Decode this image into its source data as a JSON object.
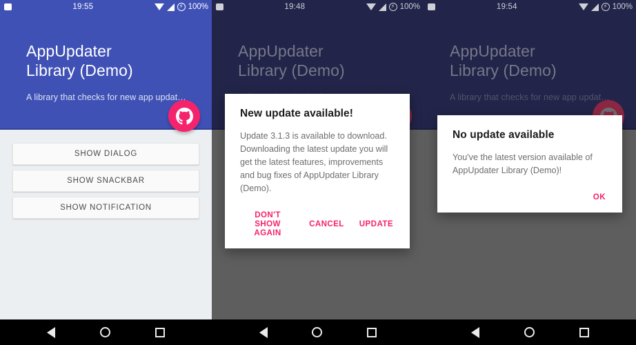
{
  "app": {
    "title_line1": "AppUpdater",
    "title_line2": "Library (Demo)",
    "subtitle": "A library that checks for new app updat…"
  },
  "colors": {
    "primary": "#3f51b5",
    "primary_dim": "#222449",
    "accent": "#f5236c",
    "accent_dim": "#8c2743",
    "body_light": "#eceff1",
    "body_dim": "#5e5e5e",
    "dialog_action": "#f5236c"
  },
  "panels": [
    {
      "name": "home",
      "statusbar": {
        "clock": "19:55",
        "battery": "100%"
      },
      "buttons": [
        {
          "label": "SHOW DIALOG"
        },
        {
          "label": "SHOW SNACKBAR"
        },
        {
          "label": "SHOW NOTIFICATION"
        }
      ],
      "fab": {
        "icon": "github-icon"
      }
    },
    {
      "name": "update-available",
      "statusbar": {
        "clock": "19:48",
        "battery": "100%"
      }
    },
    {
      "name": "no-update",
      "statusbar": {
        "clock": "19:54",
        "battery": "100%"
      }
    }
  ],
  "dialogs": {
    "update": {
      "title": "New update available!",
      "message": "Update 3.1.3 is available to download. Downloading the latest update you will get the latest features, improvements and bug fixes of AppUpdater Library (Demo).",
      "actions": {
        "dont_show_again": "DON'T SHOW AGAIN",
        "cancel": "CANCEL",
        "update": "UPDATE"
      }
    },
    "no_update": {
      "title": "No update available",
      "message": "You've the latest version available of AppUpdater Library (Demo)!",
      "actions": {
        "ok": "OK"
      }
    }
  },
  "navbar": {
    "back": "back-icon",
    "home": "home-icon",
    "recents": "recents-icon"
  }
}
